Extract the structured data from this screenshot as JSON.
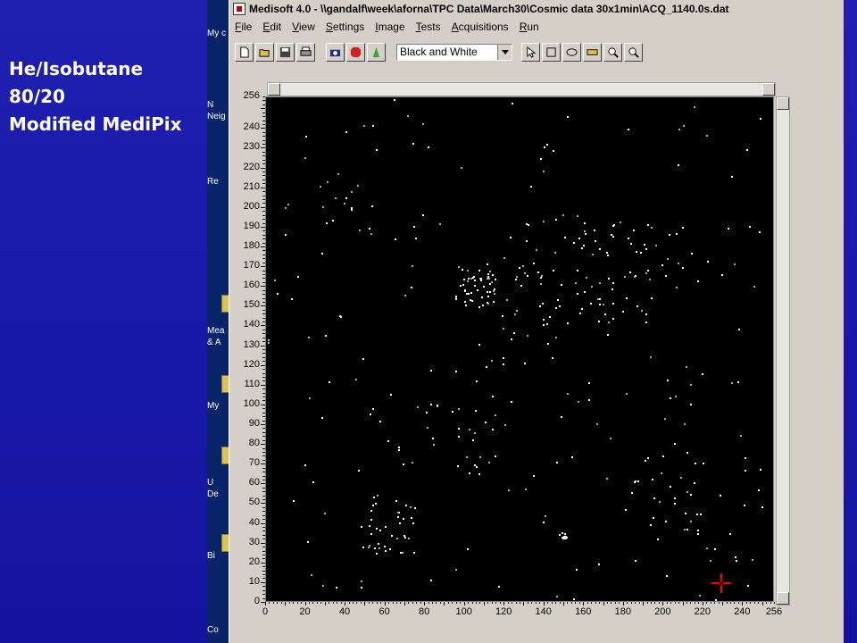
{
  "slide": {
    "label_lines": [
      "He/Isobutane",
      "80/20",
      "Modified MediPix"
    ]
  },
  "desktop": {
    "items": [
      "My c",
      "N",
      "Neig",
      "Re",
      "Mea",
      "& A",
      "My",
      "U",
      "De",
      "Bi",
      "Co"
    ]
  },
  "window": {
    "title": "Medisoft 4.0 - \\\\gandalf\\week\\aforna\\TPC Data\\March30\\Cosmic data 30x1min\\ACQ_1140.0s.dat"
  },
  "menu": [
    {
      "u": "F",
      "rest": "ile"
    },
    {
      "u": "E",
      "rest": "dit"
    },
    {
      "u": "V",
      "rest": "iew"
    },
    {
      "u": "S",
      "rest": "ettings"
    },
    {
      "u": "I",
      "rest": "mage"
    },
    {
      "u": "T",
      "rest": "ests"
    },
    {
      "u": "A",
      "rest": "cquisitions"
    },
    {
      "u": "R",
      "rest": "un"
    }
  ],
  "toolbar": {
    "colormap_value": "Black and White",
    "icons": [
      "new-file-icon",
      "open-folder-icon",
      "save-icon",
      "print-icon",
      "camera-icon",
      "stop-icon",
      "run-icon",
      "pointer-icon",
      "rectangle-icon",
      "ellipse-icon",
      "ruler-icon",
      "zoom-in-icon",
      "zoom-out-icon"
    ]
  },
  "plot": {
    "x_ticks": [
      "0",
      "20",
      "40",
      "60",
      "80",
      "100",
      "120",
      "140",
      "160",
      "180",
      "200",
      "220",
      "240",
      "256"
    ],
    "y_ticks": [
      "256",
      "240",
      "230",
      "220",
      "210",
      "200",
      "190",
      "180",
      "170",
      "160",
      "150",
      "140",
      "130",
      "120",
      "110",
      "100",
      "90",
      "80",
      "70",
      "60",
      "50",
      "40",
      "30",
      "20",
      "10",
      "0"
    ],
    "range": [
      0,
      256
    ],
    "cursor_color": "#ff0000",
    "hit_color": "#ffffff",
    "background_color": "#000000"
  }
}
